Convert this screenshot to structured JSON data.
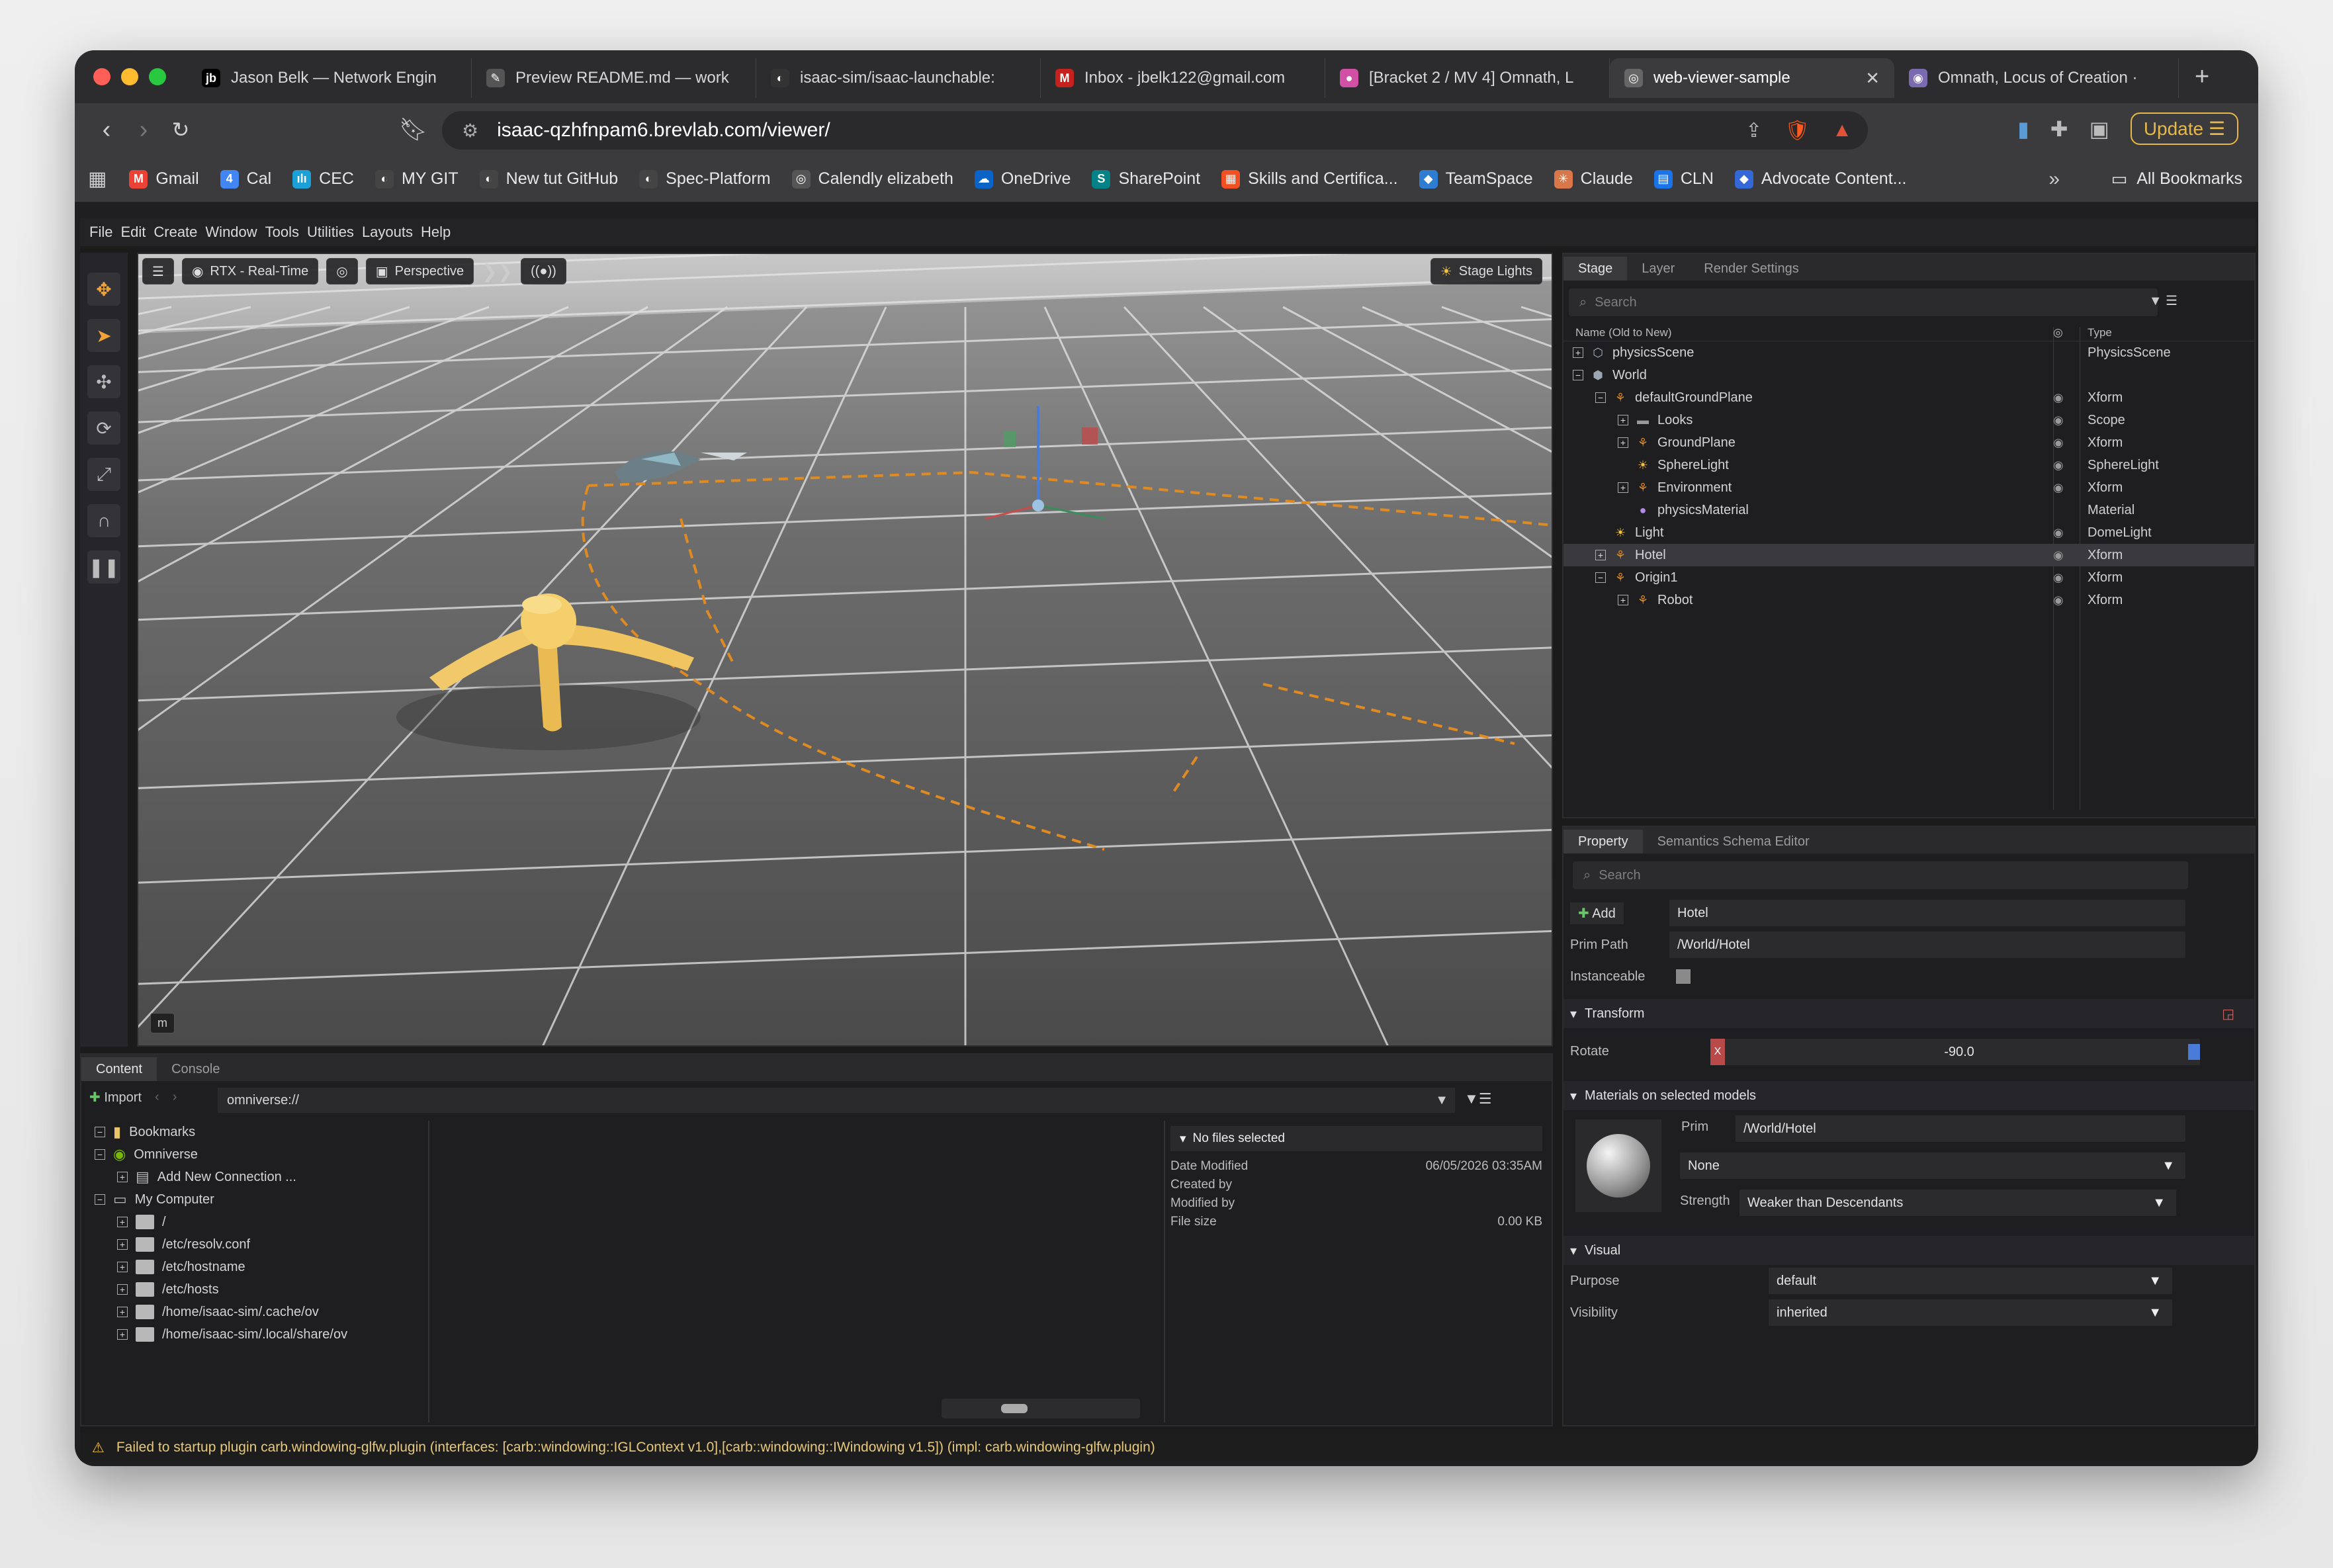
{
  "browser": {
    "tabs": [
      {
        "label": "Jason Belk — Network Engin",
        "fav": "jb",
        "color": "#000000"
      },
      {
        "label": "Preview README.md — work",
        "fav": "✎",
        "color": "#555555"
      },
      {
        "label": "isaac-sim/isaac-launchable:",
        "fav": "◐",
        "color": "#333333"
      },
      {
        "label": "Inbox - jbelk122@gmail.com",
        "fav": "M",
        "color": "#c5221f"
      },
      {
        "label": "[Bracket 2 / MV 4] Omnath, L",
        "fav": "●",
        "color": "#d14fa4"
      },
      {
        "label": "web-viewer-sample",
        "fav": "◎",
        "color": "#666666",
        "active": true
      },
      {
        "label": "Omnath, Locus of Creation ·",
        "fav": "◉",
        "color": "#7a6bb0"
      }
    ],
    "url": "isaac-qzhfnpam6.brevlab.com/viewer/",
    "update_label": "Update",
    "bookmarks": [
      {
        "label": "Gmail",
        "icon": "M",
        "color": "#ea4335"
      },
      {
        "label": "Cal",
        "icon": "4",
        "color": "#4285f4"
      },
      {
        "label": "CEC",
        "icon": "ılı",
        "color": "#1ba0d7"
      },
      {
        "label": "MY GIT",
        "icon": "◐",
        "color": "#444444"
      },
      {
        "label": "New tut GitHub",
        "icon": "◐",
        "color": "#444444"
      },
      {
        "label": "Spec-Platform",
        "icon": "◐",
        "color": "#444444"
      },
      {
        "label": "Calendly elizabeth",
        "icon": "◎",
        "color": "#555555"
      },
      {
        "label": "OneDrive",
        "icon": "☁",
        "color": "#0a64c8"
      },
      {
        "label": "SharePoint",
        "icon": "S",
        "color": "#038387"
      },
      {
        "label": "Skills and Certifica...",
        "icon": "▦",
        "color": "#f25022"
      },
      {
        "label": "TeamSpace",
        "icon": "◆",
        "color": "#2f7dd1"
      },
      {
        "label": "Claude",
        "icon": "✳",
        "color": "#d9764a"
      },
      {
        "label": "CLN",
        "icon": "▤",
        "color": "#1a73e8"
      },
      {
        "label": "Advocate Content...",
        "icon": "◆",
        "color": "#3468d6"
      }
    ],
    "all_bookmarks": "All Bookmarks"
  },
  "app": {
    "menu": [
      "File",
      "Edit",
      "Create",
      "Window",
      "Tools",
      "Utilities",
      "Layouts",
      "Help"
    ],
    "viewport": {
      "render_mode": "RTX - Real-Time",
      "camera": "Perspective",
      "lights": "Stage Lights",
      "overlay_label": "m"
    },
    "stage": {
      "tabs": [
        "Stage",
        "Layer",
        "Render Settings"
      ],
      "search_placeholder": "Search",
      "col_name": "Name (Old to New)",
      "col_type": "Type",
      "rows": [
        {
          "name": "physicsScene",
          "type": "PhysicsScene",
          "depth": 0,
          "exp": "+",
          "eye": false
        },
        {
          "name": "World",
          "type": "",
          "depth": 0,
          "exp": "−",
          "eye": false
        },
        {
          "name": "defaultGroundPlane",
          "type": "Xform",
          "depth": 1,
          "exp": "−",
          "eye": true
        },
        {
          "name": "Looks",
          "type": "Scope",
          "depth": 2,
          "exp": "+",
          "eye": true
        },
        {
          "name": "GroundPlane",
          "type": "Xform",
          "depth": 2,
          "exp": "+",
          "eye": true
        },
        {
          "name": "SphereLight",
          "type": "SphereLight",
          "depth": 2,
          "exp": "",
          "eye": true
        },
        {
          "name": "Environment",
          "type": "Xform",
          "depth": 2,
          "exp": "+",
          "eye": true
        },
        {
          "name": "physicsMaterial",
          "type": "Material",
          "depth": 2,
          "exp": "",
          "eye": false
        },
        {
          "name": "Light",
          "type": "DomeLight",
          "depth": 1,
          "exp": "",
          "eye": true
        },
        {
          "name": "Hotel",
          "type": "Xform",
          "depth": 1,
          "exp": "+",
          "eye": true,
          "selected": true
        },
        {
          "name": "Origin1",
          "type": "Xform",
          "depth": 1,
          "exp": "−",
          "eye": true
        },
        {
          "name": "Robot",
          "type": "Xform",
          "depth": 2,
          "exp": "+",
          "eye": true
        }
      ]
    },
    "property": {
      "tabs": [
        "Property",
        "Semantics Schema Editor"
      ],
      "search_placeholder": "Search",
      "add_label": "Add",
      "name_value": "Hotel",
      "prim_path_label": "Prim Path",
      "prim_path_value": "/World/Hotel",
      "instanceable_label": "Instanceable",
      "transform_label": "Transform",
      "rotate_label": "Rotate",
      "rotate_axis": "X",
      "rotate_value": "-90.0",
      "materials_label": "Materials on selected models",
      "prim_label": "Prim",
      "prim_value": "/World/Hotel",
      "material_value": "None",
      "strength_label": "Strength",
      "strength_value": "Weaker than Descendants",
      "visual_label": "Visual",
      "purpose_label": "Purpose",
      "purpose_value": "default",
      "visibility_label": "Visibility",
      "visibility_value": "inherited"
    },
    "content": {
      "tabs": [
        "Content",
        "Console"
      ],
      "import_label": "Import",
      "path": "omniverse://",
      "tree": [
        {
          "label": "Bookmarks",
          "depth": 0,
          "exp": "−",
          "kind": "bookmark"
        },
        {
          "label": "Omniverse",
          "depth": 0,
          "exp": "−",
          "kind": "omni"
        },
        {
          "label": "Add New Connection ...",
          "depth": 1,
          "exp": "+",
          "kind": "conn"
        },
        {
          "label": "My Computer",
          "depth": 0,
          "exp": "−",
          "kind": "pc"
        },
        {
          "label": "/",
          "depth": 1,
          "exp": "+",
          "kind": "folder"
        },
        {
          "label": "/etc/resolv.conf",
          "depth": 1,
          "exp": "+",
          "kind": "folder"
        },
        {
          "label": "/etc/hostname",
          "depth": 1,
          "exp": "+",
          "kind": "folder"
        },
        {
          "label": "/etc/hosts",
          "depth": 1,
          "exp": "+",
          "kind": "folder"
        },
        {
          "label": "/home/isaac-sim/.cache/ov",
          "depth": 1,
          "exp": "+",
          "kind": "folder"
        },
        {
          "label": "/home/isaac-sim/.local/share/ov",
          "depth": 1,
          "exp": "+",
          "kind": "folder"
        }
      ],
      "info_header": "No files selected",
      "date_modified_label": "Date Modified",
      "date_modified_value": "06/05/2026 03:35AM",
      "created_by_label": "Created by",
      "modified_by_label": "Modified by",
      "file_size_label": "File size",
      "file_size_value": "0.00 KB"
    },
    "status": "Failed to startup plugin carb.windowing-glfw.plugin (interfaces: [carb::windowing::IGLContext v1.0],[carb::windowing::IWindowing v1.5]) (impl: carb.windowing-glfw.plugin)"
  }
}
